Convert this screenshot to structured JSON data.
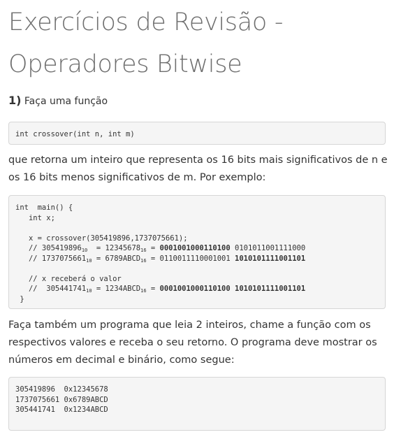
{
  "title_line1": "Exercícios de Revisão -",
  "title_line2": "Operadores Bitwise",
  "question": {
    "number": "1)",
    "text": "Faça uma função"
  },
  "signature": "int crossover(int n, int m)",
  "description": "que retorna um inteiro que representa os 16 bits mais significativos de n e os 16 bits menos significativos de m. Por exemplo:",
  "example": {
    "l1": "int  main() {",
    "l2": "   int x;",
    "l3": "   x = crossover(305419896,1737075661);",
    "l4": {
      "prefix": "   // 305419896",
      "sub1": "10",
      "mid": "  = 12345678",
      "sub2": "16",
      "eq": " = ",
      "bold": "0001001000110100",
      "rest": " 0101011001111000"
    },
    "l5": {
      "prefix": "   // 1737075661",
      "sub1": "10",
      "mid": " = 6789ABCD",
      "sub2": "16",
      "eq": " = ",
      "rest": "0110011110001001 ",
      "bold": "1010101111001101"
    },
    "l6": "   // x receberá o valor",
    "l7": {
      "prefix": "   //  305441741",
      "sub1": "10",
      "mid": " = 1234ABCD",
      "sub2": "16",
      "eq": " = ",
      "bold": "0001001000110100 1010101111001101"
    },
    "l8": " }"
  },
  "task": "Faça também um programa que leia 2 inteiros, chame a função com os respectivos valores e receba o seu retorno. O programa deve mostrar os números em decimal e binário, como segue:",
  "output": {
    "l1": "305419896  0x12345678",
    "l2": "1737075661 0x6789ABCD",
    "l3": "305441741  0x1234ABCD"
  }
}
